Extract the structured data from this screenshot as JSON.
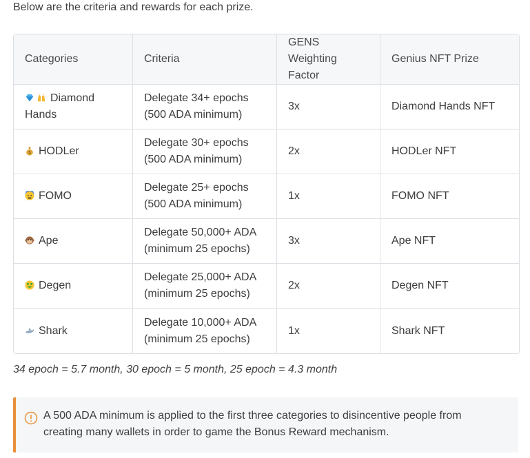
{
  "intro": "Below are the criteria and rewards for each prize.",
  "table": {
    "headers": [
      "Categories",
      "Criteria",
      "GENS Weighting Factor",
      "Genius NFT Prize"
    ],
    "rows": [
      {
        "icon": "gem-hands-raised-emoji",
        "category": "Diamond Hands",
        "criteria_line1": "Delegate 34+ epochs",
        "criteria_line2": "(500 ADA minimum)",
        "weight": "3x",
        "prize": "Diamond Hands NFT"
      },
      {
        "icon": "money-bag-emoji",
        "category": "HODLer",
        "criteria_line1": "Delegate 30+ epochs",
        "criteria_line2": "(500 ADA minimum)",
        "weight": "2x",
        "prize": "HODLer NFT"
      },
      {
        "icon": "anxious-face-emoji",
        "category": "FOMO",
        "criteria_line1": "Delegate 25+ epochs",
        "criteria_line2": "(500 ADA minimum)",
        "weight": "1x",
        "prize": "FOMO NFT"
      },
      {
        "icon": "monkey-face-emoji",
        "category": "Ape",
        "criteria_line1": "Delegate 50,000+ ADA",
        "criteria_line2": "(minimum 25 epochs)",
        "weight": "3x",
        "prize": "Ape NFT"
      },
      {
        "icon": "money-mouth-face-emoji",
        "category": "Degen",
        "criteria_line1": "Delegate 25,000+ ADA",
        "criteria_line2": "(minimum 25 epochs)",
        "weight": "2x",
        "prize": "Degen NFT"
      },
      {
        "icon": "shark-emoji",
        "category": "Shark",
        "criteria_line1": "Delegate 10,000+ ADA",
        "criteria_line2": "(minimum 25 epochs)",
        "weight": "1x",
        "prize": "Shark NFT"
      }
    ]
  },
  "note": "34 epoch = 5.7 month, 30 epoch = 5 month, 25 epoch = 4.3 month",
  "callout": {
    "icon": "warning-circle-icon",
    "accent": "#e8903a",
    "text": "A 500 ADA minimum is applied to the first three categories to disincentive people from creating many wallets in order to game the Bonus Reward mechanism."
  }
}
